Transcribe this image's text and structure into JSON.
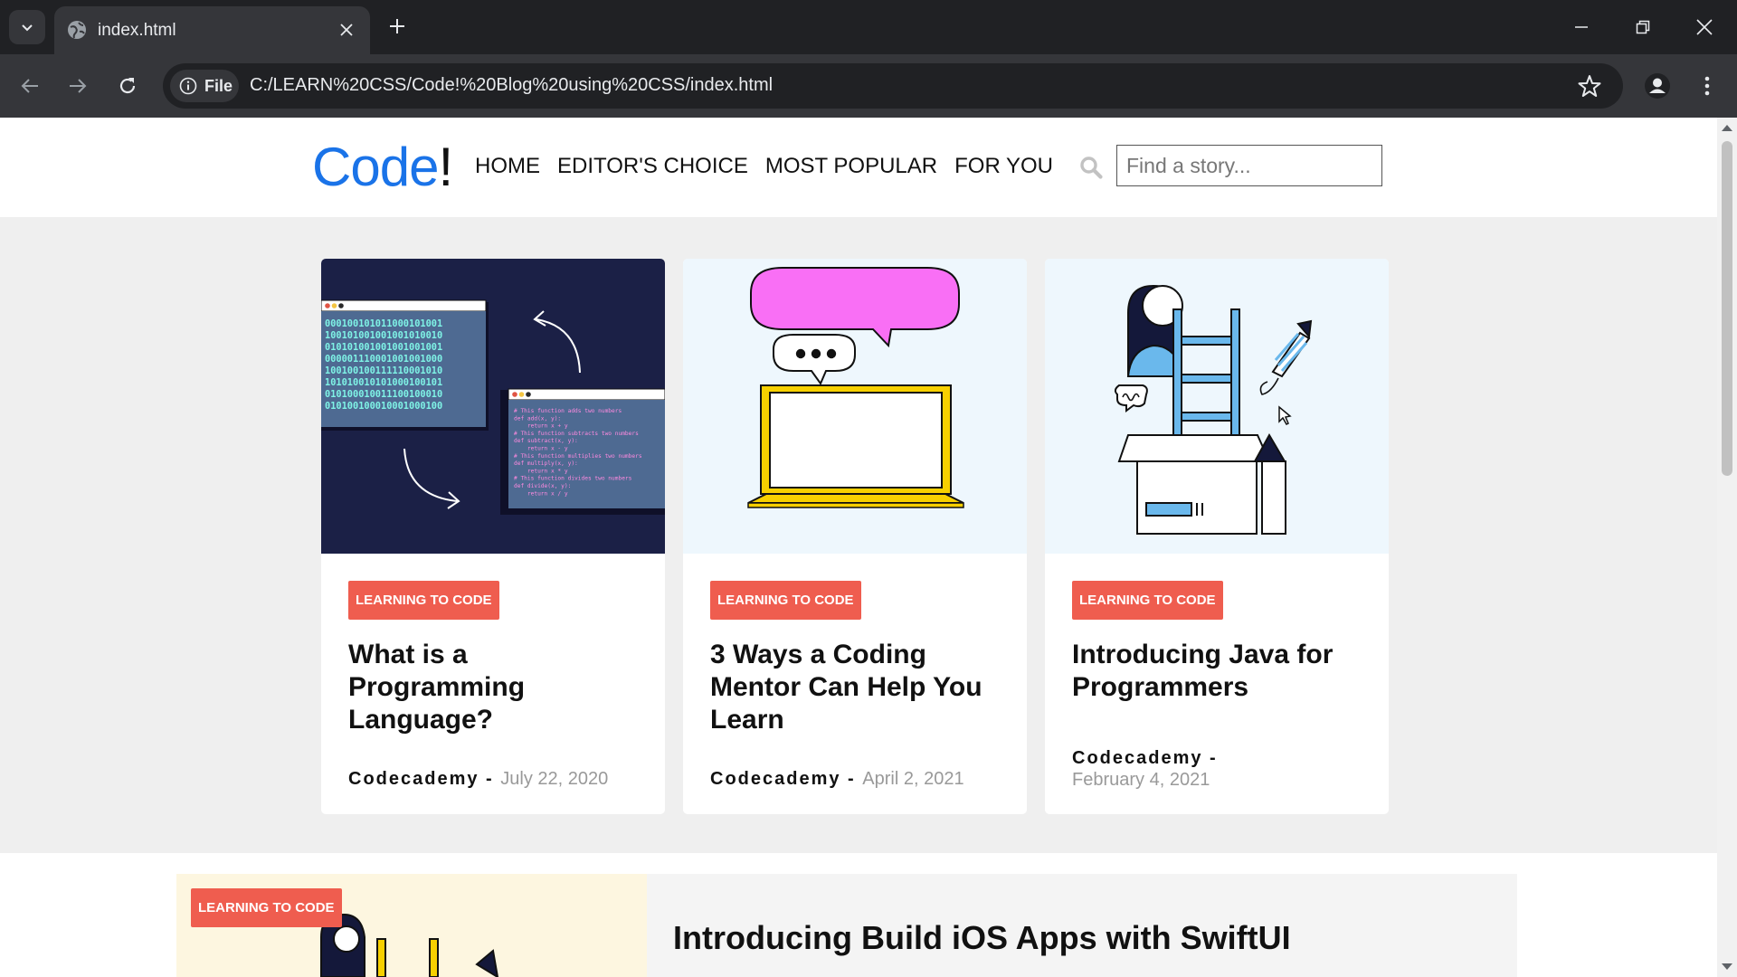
{
  "browser": {
    "tab_title": "index.html",
    "chip_label": "File",
    "url": "C:/LEARN%20CSS/Code!%20Blog%20using%20CSS/index.html"
  },
  "site": {
    "logo_main": "Code",
    "logo_bang": "!",
    "nav": [
      "HOME",
      "EDITOR'S CHOICE",
      "MOST POPULAR",
      "FOR YOU"
    ],
    "search_placeholder": "Find a story..."
  },
  "cards": [
    {
      "tag": "LEARNING TO CODE",
      "title": "What is a Programming Language?",
      "author": "Codecademy",
      "separator": " - ",
      "date": "July 22, 2020"
    },
    {
      "tag": "LEARNING TO CODE",
      "title": "3 Ways a Coding Mentor Can Help You Learn",
      "author": "Codecademy",
      "separator": " - ",
      "date": "April 2, 2021"
    },
    {
      "tag": "LEARNING TO CODE",
      "title": "Introducing Java for Programmers",
      "author": "Codecademy",
      "separator": " -",
      "date": "February 4, 2021"
    }
  ],
  "featured": {
    "tag": "LEARNING TO CODE",
    "title": "Introducing Build iOS Apps with SwiftUI"
  },
  "illustration": {
    "binary_lines": [
      "000100101011000101001",
      "100101001001001010010",
      "010101001001001001001",
      "000001110001001001000",
      "100100100111110001010",
      "101010010101000100101",
      "010100010011100100010",
      "010100100010001000100"
    ],
    "code_lines": [
      "# This function adds two numbers",
      "def add(x, y):",
      "    return x + y",
      "# This function subtracts two numbers",
      "def subtract(x, y):",
      "    return x - y",
      "# This function multiplies two numbers",
      "def multiply(x, y):",
      "    return x * y",
      "# This function divides two numbers",
      "def divide(x, y):",
      "    return x / y"
    ]
  },
  "colors": {
    "accent": "#1a73e8",
    "tag": "#ef5d4f",
    "chrome_dark": "#202124",
    "chrome": "#35363a"
  }
}
